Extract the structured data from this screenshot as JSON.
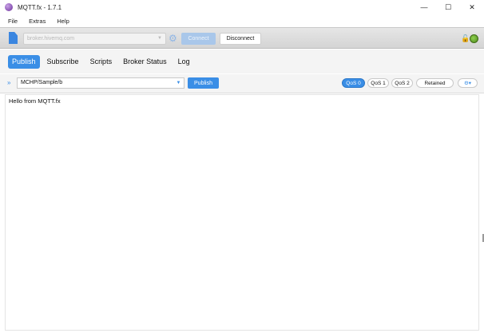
{
  "window": {
    "title": "MQTT.fx - 1.7.1",
    "minimize": "—",
    "maximize": "☐",
    "close": "✕"
  },
  "menu": [
    "File",
    "Extras",
    "Help"
  ],
  "connection": {
    "broker": "broker.hivemq.com",
    "connect_label": "Connect",
    "disconnect_label": "Disconnect",
    "status_color": "#6ab034"
  },
  "tabs": [
    "Publish",
    "Subscribe",
    "Scripts",
    "Broker Status",
    "Log"
  ],
  "active_tab": "Publish",
  "publish": {
    "topic": "MCHP/Sample/b",
    "publish_label": "Publish",
    "qos": [
      "QoS 0",
      "QoS 1",
      "QoS 2"
    ],
    "selected_qos": "QoS 0",
    "retained_label": "Retained",
    "options_label": "⚙▾"
  },
  "message": "Hello from MQTT.fx",
  "colors": {
    "accent": "#3a8ee6"
  }
}
